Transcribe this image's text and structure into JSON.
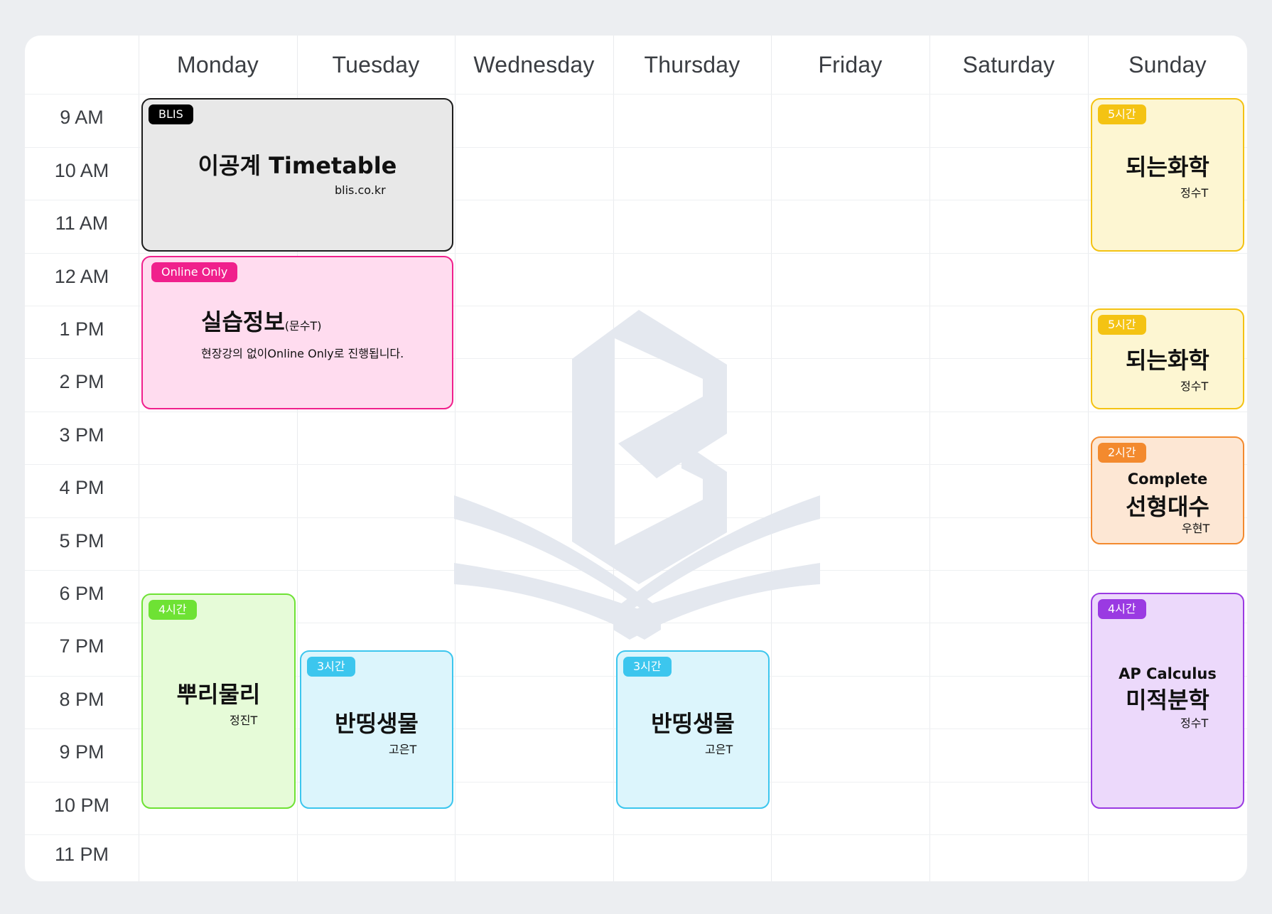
{
  "days": [
    "Monday",
    "Tuesday",
    "Wednesday",
    "Thursday",
    "Friday",
    "Saturday",
    "Sunday"
  ],
  "times": [
    "9 AM",
    "10 AM",
    "11 AM",
    "12 AM",
    "1 PM",
    "2 PM",
    "3 PM",
    "4 PM",
    "5 PM",
    "6 PM",
    "7 PM",
    "8 PM",
    "9 PM",
    "10 PM",
    "11 PM"
  ],
  "colors": {
    "background": "#eceef1",
    "card": "#ffffff",
    "gray_fill": "#e8e8e8",
    "pink_fill": "#ffdcef",
    "pink_accent": "#f0208c",
    "green_fill": "#e6fbd8",
    "green_accent": "#6ee234",
    "cyan_fill": "#dcf5fc",
    "cyan_accent": "#3cc6ee",
    "yellow_fill": "#fdf6d2",
    "yellow_accent": "#f4c313",
    "orange_fill": "#fde7d4",
    "orange_accent": "#f38a2e",
    "purple_fill": "#ecd9fb",
    "purple_accent": "#9a3ae2",
    "watermark": "#e4e8ef"
  },
  "events": {
    "blis": {
      "badge": "BLIS",
      "title": "이공계 Timetable",
      "sub": "blis.co.kr"
    },
    "online": {
      "badge": "Online Only",
      "title": "실습정보",
      "title_suffix": "(문수T)",
      "sub": "현장강의 없이Online Only로 진행됩니다."
    },
    "mon_bio": {
      "badge": "4시간",
      "title": "뿌리물리",
      "sub": "정진T"
    },
    "tue_bio": {
      "badge": "3시간",
      "title": "반띵생물",
      "sub": "고은T"
    },
    "thu_bio": {
      "badge": "3시간",
      "title": "반띵생물",
      "sub": "고은T"
    },
    "sun_chem1": {
      "badge": "5시간",
      "title": "되는화학",
      "sub": "정수T"
    },
    "sun_chem2": {
      "badge": "5시간",
      "title": "되는화학",
      "sub": "정수T"
    },
    "sun_linear": {
      "badge": "2시간",
      "pre": "Complete",
      "title": "선형대수",
      "sub": "우현T"
    },
    "sun_calc": {
      "badge": "4시간",
      "pre": "AP Calculus",
      "title": "미적분학",
      "sub": "정수T"
    }
  }
}
